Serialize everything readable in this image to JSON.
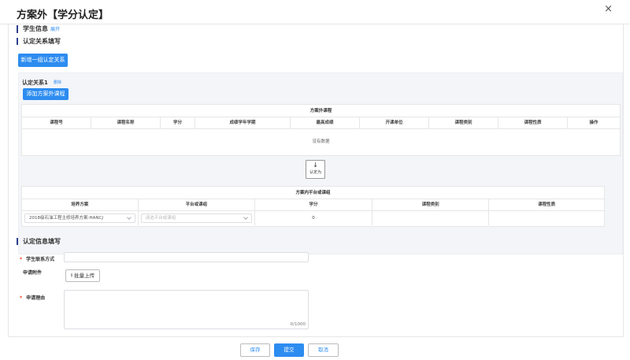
{
  "dialog": {
    "title": "方案外【学分认定】",
    "close": "×"
  },
  "student_info": {
    "heading": "学生信息",
    "expand": "展开"
  },
  "relation_section": {
    "heading": "认定关系填写",
    "add_group_button": "新增一组认定关系"
  },
  "relation1": {
    "title": "认定关系1",
    "delete": "删除",
    "add_course_button": "添加方案外课程",
    "outside_table": {
      "caption": "方案外课程",
      "columns": [
        "课程号",
        "课程名称",
        "学分",
        "成绩学年学期",
        "最高成绩",
        "开课单位",
        "课程类别",
        "课程性质",
        "操作"
      ],
      "empty_text": "没有数据"
    },
    "convert": {
      "arrow": "↓",
      "label": "认定为"
    },
    "inside_table": {
      "caption": "方案内平台或课组",
      "columns": [
        "培养方案",
        "平台或课组",
        "学分",
        "课程类别",
        "课程性质"
      ],
      "row": {
        "plan": "2018级石油工程主修培养方案-HANCJ",
        "platform_placeholder": "请选平台或课组",
        "credit": "0",
        "category": "",
        "nature": ""
      }
    }
  },
  "info_section": {
    "heading": "认定信息填写",
    "contact_label": "学生联系方式",
    "contact_value": "",
    "attachment_label": "申请附件",
    "upload_button": "批量上传",
    "upload_icon": "⭱",
    "reason_label": "申请理由",
    "reason_value": "",
    "counter": "0/1000"
  },
  "footer": {
    "save": "保存",
    "submit": "提交",
    "cancel": "取消"
  }
}
